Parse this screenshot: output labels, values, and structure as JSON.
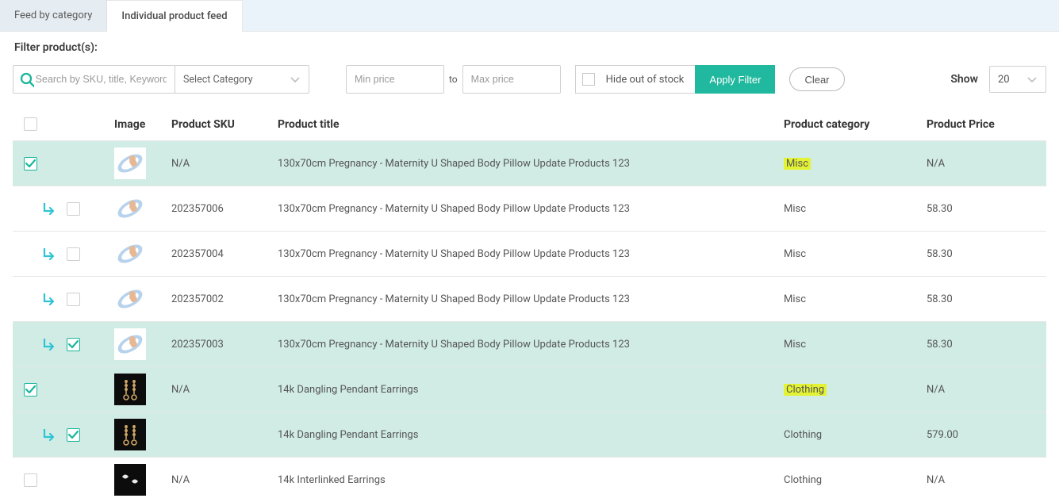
{
  "tabs": {
    "feed_by_category": "Feed by category",
    "individual": "Individual product feed"
  },
  "filter": {
    "title": "Filter product(s):",
    "search_placeholder": "Search by SKU, title, Keyword",
    "category_placeholder": "Select Category",
    "min_price_placeholder": "Min price",
    "to_label": "to",
    "max_price_placeholder": "Max price",
    "hide_oos_label": "Hide out of stock",
    "apply_label": "Apply Filter",
    "clear_label": "Clear",
    "show_label": "Show",
    "show_value": "20"
  },
  "columns": {
    "image": "Image",
    "sku": "Product SKU",
    "title": "Product title",
    "category": "Product category",
    "price": "Product Price"
  },
  "rows": [
    {
      "child": false,
      "checked": true,
      "highlighted": true,
      "thumb": "pillow",
      "sku": "N/A",
      "title": "130x70cm Pregnancy - Maternity U Shaped Body Pillow Update Products 123",
      "category": "Misc",
      "price": "N/A"
    },
    {
      "child": true,
      "checked": false,
      "highlighted": false,
      "thumb": "pillow",
      "sku": "202357006",
      "title": "130x70cm Pregnancy - Maternity U Shaped Body Pillow Update Products 123",
      "category": "Misc",
      "price": "58.30"
    },
    {
      "child": true,
      "checked": false,
      "highlighted": false,
      "thumb": "pillow",
      "sku": "202357004",
      "title": "130x70cm Pregnancy - Maternity U Shaped Body Pillow Update Products 123",
      "category": "Misc",
      "price": "58.30"
    },
    {
      "child": true,
      "checked": false,
      "highlighted": false,
      "thumb": "pillow",
      "sku": "202357002",
      "title": "130x70cm Pregnancy - Maternity U Shaped Body Pillow Update Products 123",
      "category": "Misc",
      "price": "58.30"
    },
    {
      "child": true,
      "checked": true,
      "highlighted": false,
      "thumb": "pillow",
      "sku": "202357003",
      "title": "130x70cm Pregnancy - Maternity U Shaped Body Pillow Update Products 123",
      "category": "Misc",
      "price": "58.30"
    },
    {
      "child": false,
      "checked": true,
      "highlighted": true,
      "thumb": "earrings",
      "sku": "N/A",
      "title": "14k Dangling Pendant Earrings",
      "category": "Clothing",
      "price": "N/A"
    },
    {
      "child": true,
      "checked": true,
      "highlighted": false,
      "thumb": "earrings",
      "sku": "",
      "title": "14k Dangling Pendant Earrings",
      "category": "Clothing",
      "price": "579.00"
    },
    {
      "child": false,
      "checked": false,
      "highlighted": false,
      "thumb": "earrings2",
      "sku": "N/A",
      "title": "14k Interlinked Earrings",
      "category": "Clothing",
      "price": "N/A"
    }
  ]
}
